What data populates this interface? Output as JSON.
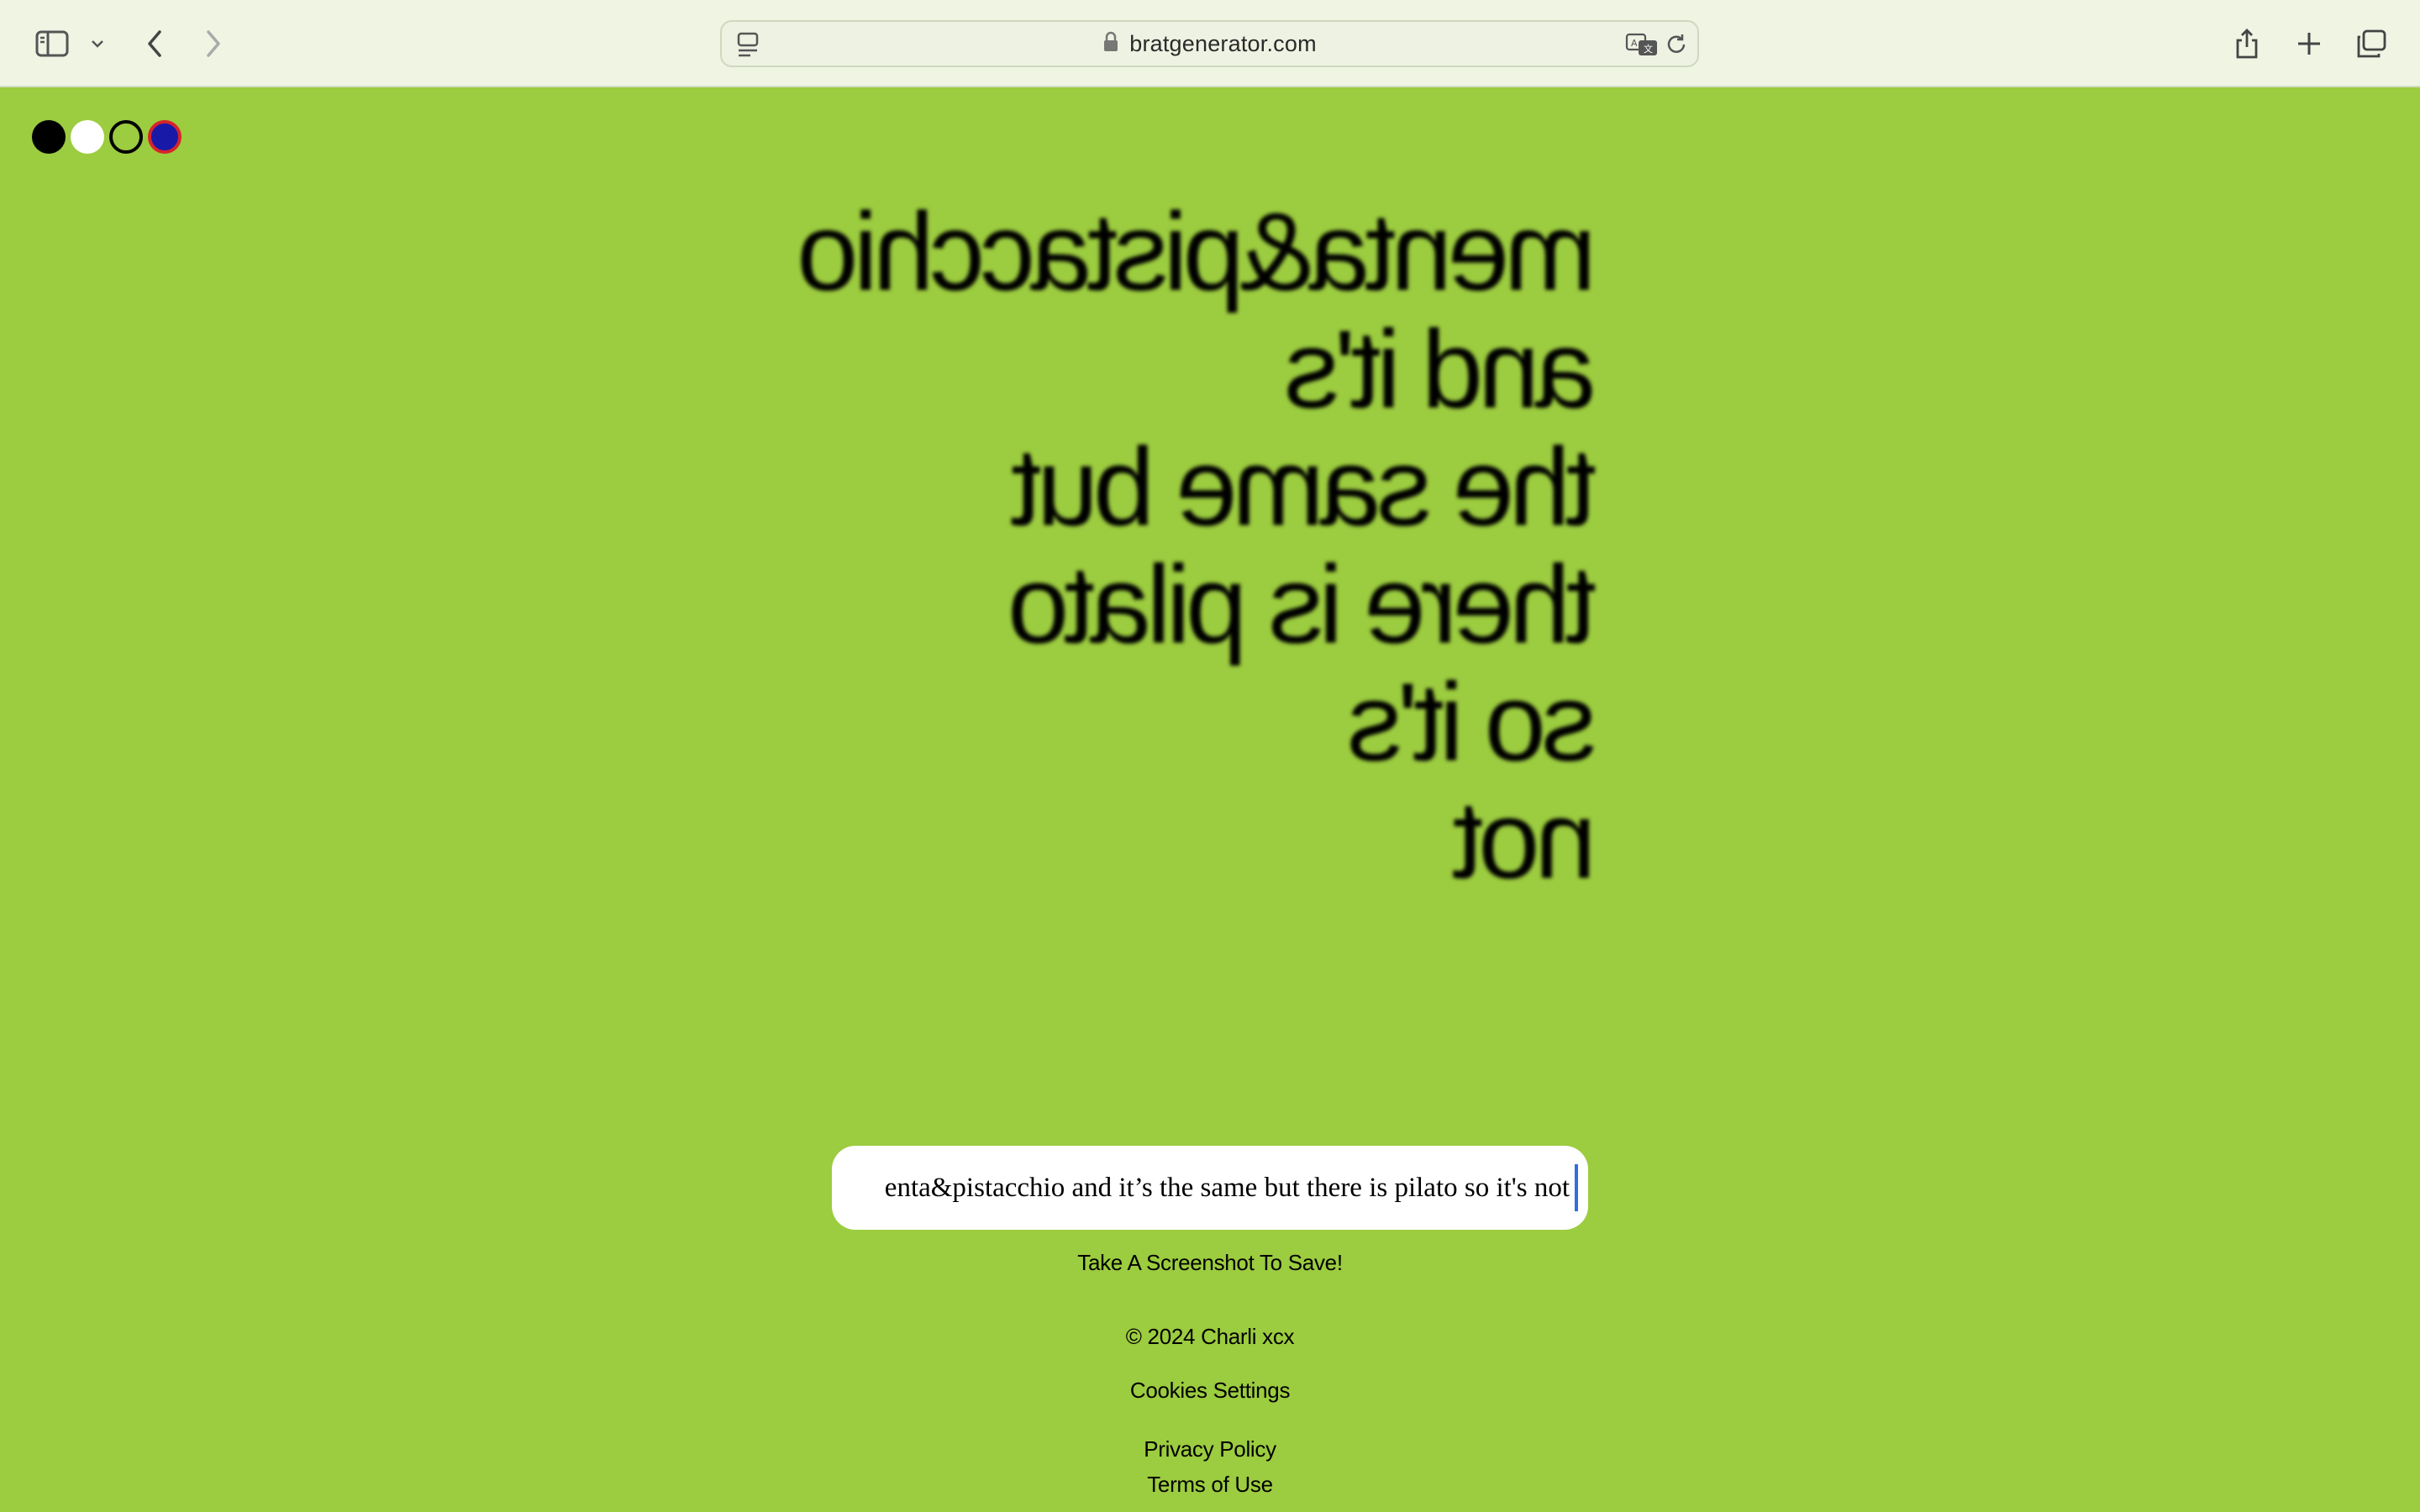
{
  "browser": {
    "url": "bratgenerator.com",
    "icons": {
      "sidebar": "sidebar-icon",
      "dropdown": "chevron-down-icon",
      "back": "back-arrow-icon",
      "forward": "forward-arrow-icon",
      "reader": "reader-icon",
      "lock": "lock-icon",
      "translate": "translate-icon",
      "reload": "reload-icon",
      "share": "share-icon",
      "new_tab": "plus-icon",
      "tabs": "tab-overview-icon"
    }
  },
  "colors": {
    "page_background": "#9ccc3f",
    "toolbar_background": "#eff4e3",
    "swatches": [
      "#000000",
      "#ffffff",
      "outline-black",
      "#1919a8"
    ]
  },
  "brat": {
    "lines": [
      "menta&pistacchio",
      "and it's",
      "the same but",
      "there is pilato",
      "so it's",
      "not"
    ],
    "mirrored": true,
    "blurred": true
  },
  "input": {
    "value": "enta&pistacchio and it’s the same but there is pilato so it's not"
  },
  "footer": {
    "save_hint": "Take A Screenshot To Save!",
    "copyright": "© 2024 Charli xcx",
    "cookies": "Cookies Settings",
    "privacy": "Privacy Policy",
    "terms": "Terms of Use"
  }
}
